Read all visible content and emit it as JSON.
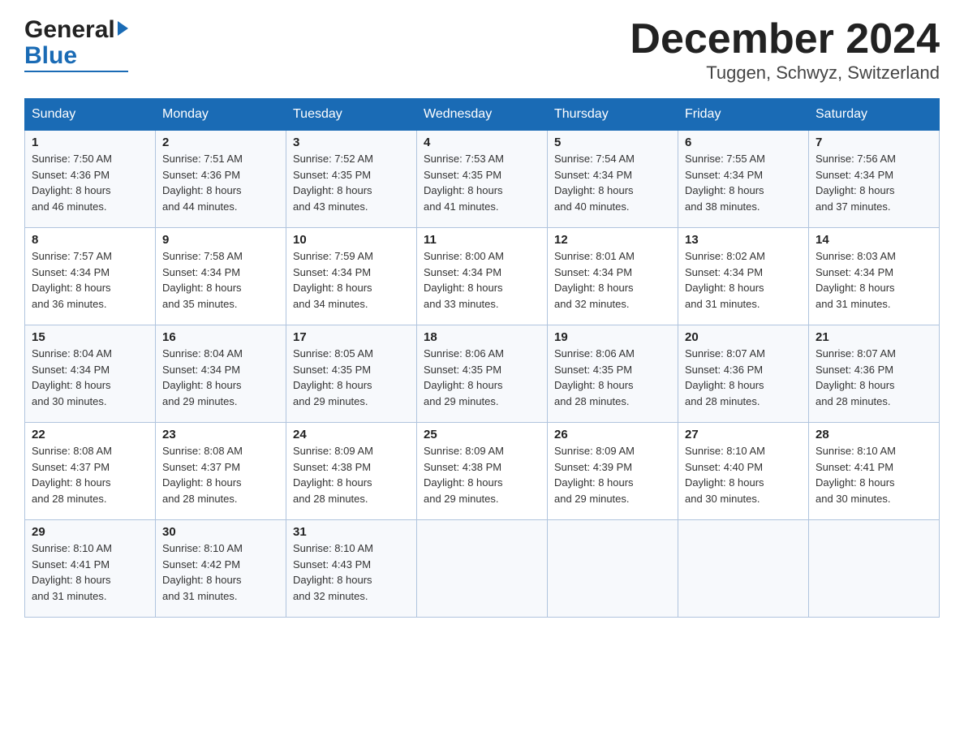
{
  "header": {
    "title": "December 2024",
    "subtitle": "Tuggen, Schwyz, Switzerland",
    "logo_general": "General",
    "logo_blue": "Blue"
  },
  "columns": [
    "Sunday",
    "Monday",
    "Tuesday",
    "Wednesday",
    "Thursday",
    "Friday",
    "Saturday"
  ],
  "weeks": [
    [
      {
        "day": "1",
        "sunrise": "7:50 AM",
        "sunset": "4:36 PM",
        "daylight": "8 hours and 46 minutes."
      },
      {
        "day": "2",
        "sunrise": "7:51 AM",
        "sunset": "4:36 PM",
        "daylight": "8 hours and 44 minutes."
      },
      {
        "day": "3",
        "sunrise": "7:52 AM",
        "sunset": "4:35 PM",
        "daylight": "8 hours and 43 minutes."
      },
      {
        "day": "4",
        "sunrise": "7:53 AM",
        "sunset": "4:35 PM",
        "daylight": "8 hours and 41 minutes."
      },
      {
        "day": "5",
        "sunrise": "7:54 AM",
        "sunset": "4:34 PM",
        "daylight": "8 hours and 40 minutes."
      },
      {
        "day": "6",
        "sunrise": "7:55 AM",
        "sunset": "4:34 PM",
        "daylight": "8 hours and 38 minutes."
      },
      {
        "day": "7",
        "sunrise": "7:56 AM",
        "sunset": "4:34 PM",
        "daylight": "8 hours and 37 minutes."
      }
    ],
    [
      {
        "day": "8",
        "sunrise": "7:57 AM",
        "sunset": "4:34 PM",
        "daylight": "8 hours and 36 minutes."
      },
      {
        "day": "9",
        "sunrise": "7:58 AM",
        "sunset": "4:34 PM",
        "daylight": "8 hours and 35 minutes."
      },
      {
        "day": "10",
        "sunrise": "7:59 AM",
        "sunset": "4:34 PM",
        "daylight": "8 hours and 34 minutes."
      },
      {
        "day": "11",
        "sunrise": "8:00 AM",
        "sunset": "4:34 PM",
        "daylight": "8 hours and 33 minutes."
      },
      {
        "day": "12",
        "sunrise": "8:01 AM",
        "sunset": "4:34 PM",
        "daylight": "8 hours and 32 minutes."
      },
      {
        "day": "13",
        "sunrise": "8:02 AM",
        "sunset": "4:34 PM",
        "daylight": "8 hours and 31 minutes."
      },
      {
        "day": "14",
        "sunrise": "8:03 AM",
        "sunset": "4:34 PM",
        "daylight": "8 hours and 31 minutes."
      }
    ],
    [
      {
        "day": "15",
        "sunrise": "8:04 AM",
        "sunset": "4:34 PM",
        "daylight": "8 hours and 30 minutes."
      },
      {
        "day": "16",
        "sunrise": "8:04 AM",
        "sunset": "4:34 PM",
        "daylight": "8 hours and 29 minutes."
      },
      {
        "day": "17",
        "sunrise": "8:05 AM",
        "sunset": "4:35 PM",
        "daylight": "8 hours and 29 minutes."
      },
      {
        "day": "18",
        "sunrise": "8:06 AM",
        "sunset": "4:35 PM",
        "daylight": "8 hours and 29 minutes."
      },
      {
        "day": "19",
        "sunrise": "8:06 AM",
        "sunset": "4:35 PM",
        "daylight": "8 hours and 28 minutes."
      },
      {
        "day": "20",
        "sunrise": "8:07 AM",
        "sunset": "4:36 PM",
        "daylight": "8 hours and 28 minutes."
      },
      {
        "day": "21",
        "sunrise": "8:07 AM",
        "sunset": "4:36 PM",
        "daylight": "8 hours and 28 minutes."
      }
    ],
    [
      {
        "day": "22",
        "sunrise": "8:08 AM",
        "sunset": "4:37 PM",
        "daylight": "8 hours and 28 minutes."
      },
      {
        "day": "23",
        "sunrise": "8:08 AM",
        "sunset": "4:37 PM",
        "daylight": "8 hours and 28 minutes."
      },
      {
        "day": "24",
        "sunrise": "8:09 AM",
        "sunset": "4:38 PM",
        "daylight": "8 hours and 28 minutes."
      },
      {
        "day": "25",
        "sunrise": "8:09 AM",
        "sunset": "4:38 PM",
        "daylight": "8 hours and 29 minutes."
      },
      {
        "day": "26",
        "sunrise": "8:09 AM",
        "sunset": "4:39 PM",
        "daylight": "8 hours and 29 minutes."
      },
      {
        "day": "27",
        "sunrise": "8:10 AM",
        "sunset": "4:40 PM",
        "daylight": "8 hours and 30 minutes."
      },
      {
        "day": "28",
        "sunrise": "8:10 AM",
        "sunset": "4:41 PM",
        "daylight": "8 hours and 30 minutes."
      }
    ],
    [
      {
        "day": "29",
        "sunrise": "8:10 AM",
        "sunset": "4:41 PM",
        "daylight": "8 hours and 31 minutes."
      },
      {
        "day": "30",
        "sunrise": "8:10 AM",
        "sunset": "4:42 PM",
        "daylight": "8 hours and 31 minutes."
      },
      {
        "day": "31",
        "sunrise": "8:10 AM",
        "sunset": "4:43 PM",
        "daylight": "8 hours and 32 minutes."
      },
      {
        "day": "",
        "sunrise": "",
        "sunset": "",
        "daylight": ""
      },
      {
        "day": "",
        "sunrise": "",
        "sunset": "",
        "daylight": ""
      },
      {
        "day": "",
        "sunrise": "",
        "sunset": "",
        "daylight": ""
      },
      {
        "day": "",
        "sunrise": "",
        "sunset": "",
        "daylight": ""
      }
    ]
  ],
  "labels": {
    "sunrise": "Sunrise:",
    "sunset": "Sunset:",
    "daylight": "Daylight:"
  }
}
